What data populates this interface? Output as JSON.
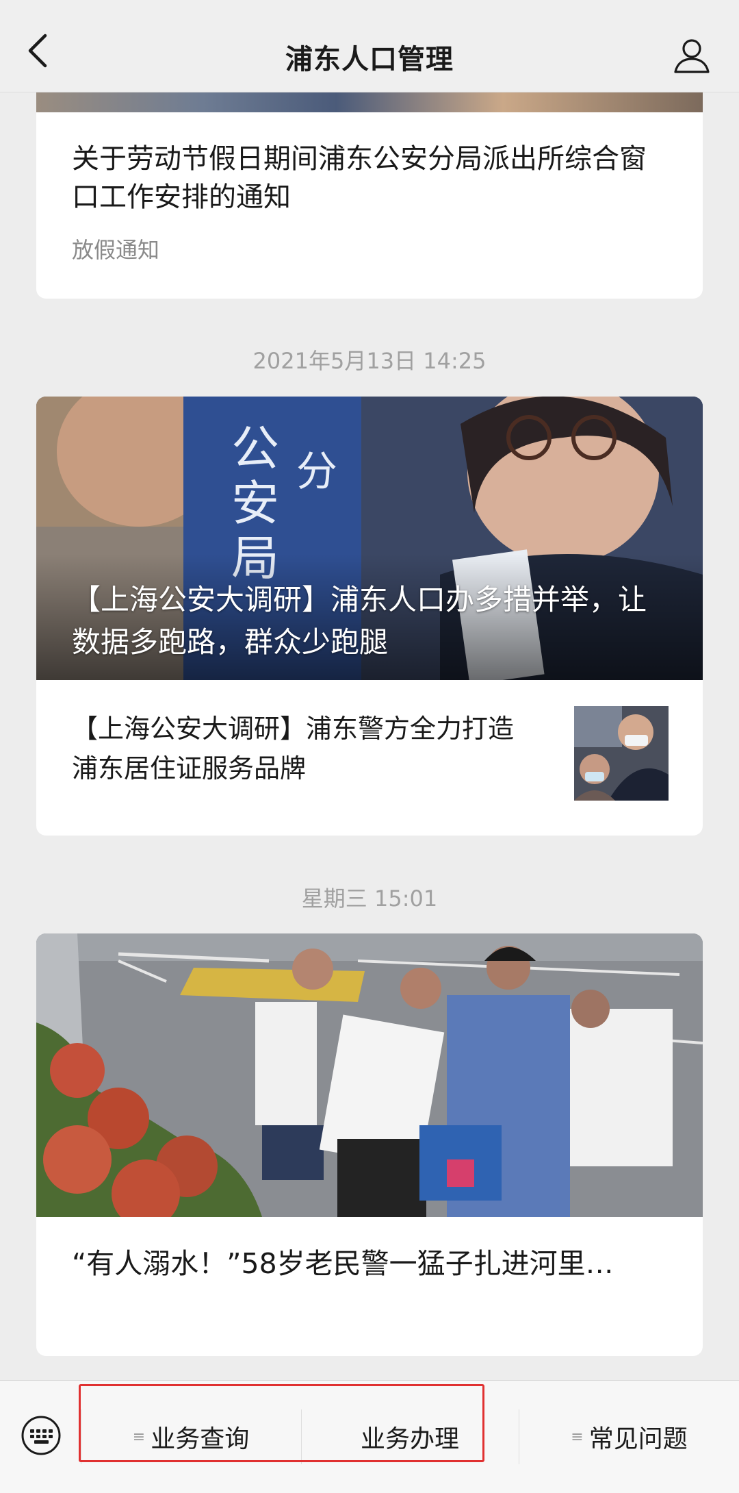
{
  "nav": {
    "title": "浦东人口管理",
    "back_icon": "chevron-left-icon",
    "user_icon": "user-icon"
  },
  "feed": {
    "card1": {
      "title": "关于劳动节假日期间浦东公安分局派出所综合窗口工作安排的通知",
      "tag": "放假通知"
    },
    "time1": "2021年5月13日 14:25",
    "card2": {
      "hero_title": "【上海公安大调研】浦东人口办多措并举，让数据多跑路，群众少跑腿",
      "sub_title": "【上海公安大调研】浦东警方全力打造浦东居住证服务品牌"
    },
    "time2": "星期三 15:01",
    "card3": {
      "title": "“有人溺水！”58岁老民警一猛子扎进河里…"
    }
  },
  "menu": {
    "keyboard_icon": "keyboard-icon",
    "items": [
      {
        "label": "业务查询",
        "icon": "menu-list-icon"
      },
      {
        "label": "业务办理"
      },
      {
        "label": "常见问题",
        "icon": "menu-list-icon"
      }
    ],
    "highlight_color": "#e03131"
  }
}
